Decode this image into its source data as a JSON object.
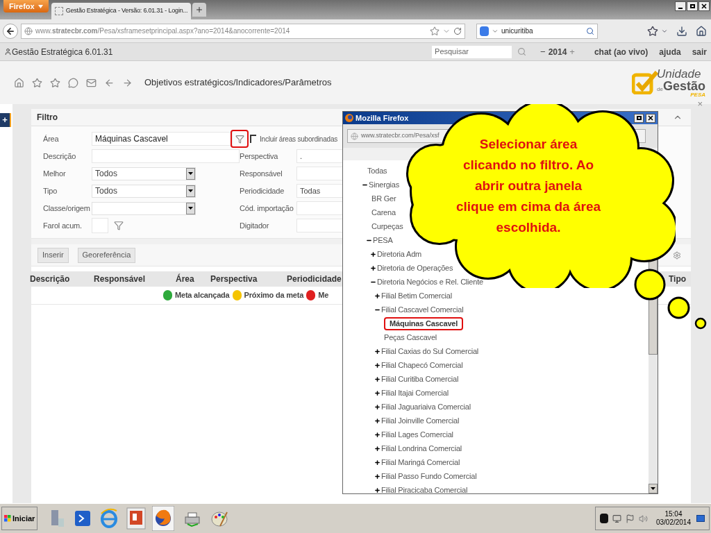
{
  "browser": {
    "menu_button": "Firefox",
    "tab_title": "Gestão Estratégica - Versão: 6.01.31 - Login...",
    "url": "www.**stratecbr.com**/Pesa/xsframesetprincipal.aspx?ano=2014&anocorrente=2014",
    "search_value": "unicuritiba"
  },
  "app_header": {
    "title": "Gestão Estratégica 6.01.31",
    "search_placeholder": "Pesquisar",
    "year_minus": "−",
    "year": "2014",
    "year_plus": "+",
    "links": [
      "chat (ao vivo)",
      "ajuda",
      "sair"
    ]
  },
  "toolbar": {
    "breadcrumb": "Objetivos estratégicos/Indicadores/Parâmetros",
    "close": "×"
  },
  "logo": {
    "line1": "Unidade",
    "small": "de",
    "line2": "Gestão",
    "tag": "PESA"
  },
  "sidebar_toggle": "+",
  "filter": {
    "title": "Filtro",
    "left_fields": [
      {
        "label": "Área",
        "kind": "area",
        "value": "Máquinas Cascavel"
      },
      {
        "label": "Descrição",
        "kind": "text"
      },
      {
        "label": "Melhor",
        "kind": "select",
        "value": "Todos"
      },
      {
        "label": "Tipo",
        "kind": "select",
        "value": "Todos"
      },
      {
        "label": "Classe/origem",
        "kind": "select"
      },
      {
        "label": "Farol acum.",
        "kind": "farol"
      }
    ],
    "include_subareas": {
      "label": "Incluir áreas subordinadas",
      "checked": false
    },
    "right_fields": [
      {
        "label": "Perspectiva",
        "value": "."
      },
      {
        "label": "Responsável"
      },
      {
        "label": "Periodicidade",
        "value": "Todas"
      },
      {
        "label": "Cód. importação"
      },
      {
        "label": "Digitador"
      }
    ]
  },
  "actions": [
    "Inserir",
    "Georeferência"
  ],
  "table": {
    "columns": [
      "Descrição",
      "Responsável",
      "Área",
      "Perspectiva",
      "Periodicidade",
      "Tipo"
    ],
    "legend": [
      {
        "label": "Meta alcançada",
        "color": "#2eaa3c"
      },
      {
        "label": "Próximo da meta",
        "color": "#f5c400"
      },
      {
        "label": "Me",
        "color": "#e02020"
      }
    ]
  },
  "popup": {
    "title": "Mozilla Firefox",
    "url": "www.stratecbr.com/Pesa/xsf",
    "tree": [
      {
        "label": "Todas",
        "selected": false
      },
      {
        "label": "Sinergias",
        "selected": false,
        "expanded": true,
        "children": [
          {
            "label": "BR Ger",
            "selected": false
          },
          {
            "label": "Carena",
            "selected": false
          },
          {
            "label": "Curpeças",
            "selected": false
          },
          {
            "label": "PESA",
            "selected": false,
            "expanded": true,
            "children": [
              {
                "label": "Diretoria Adm",
                "selected": false,
                "expanded": false
              },
              {
                "label": "Diretoria de Operações",
                "selected": false,
                "expanded": false
              },
              {
                "label": "Diretoria Negócios e Rel. Cliente",
                "selected": false,
                "expanded": true,
                "children": [
                  {
                    "label": "Filial Betim Comercial",
                    "selected": false,
                    "expanded": false
                  },
                  {
                    "label": "Filial Cascavel Comercial",
                    "selected": false,
                    "expanded": true,
                    "children": [
                      {
                        "label": "Máquinas Cascavel",
                        "selected": true
                      },
                      {
                        "label": "Peças Cascavel",
                        "selected": false
                      }
                    ]
                  },
                  {
                    "label": "Filial Caxias do Sul Comercial",
                    "selected": false,
                    "expanded": false
                  },
                  {
                    "label": "Filial Chapecó Comercial",
                    "selected": false,
                    "expanded": false
                  },
                  {
                    "label": "Filial Curitiba Comercial",
                    "selected": false,
                    "expanded": false
                  },
                  {
                    "label": "Filial Itajai Comercial",
                    "selected": false,
                    "expanded": false
                  },
                  {
                    "label": "Filial Jaguariaiva Comercial",
                    "selected": false,
                    "expanded": false
                  },
                  {
                    "label": "Filial Joinville Comercial",
                    "selected": false,
                    "expanded": false
                  },
                  {
                    "label": "Filial Lages Comercial",
                    "selected": false,
                    "expanded": false
                  },
                  {
                    "label": "Filial Londrina Comercial",
                    "selected": false,
                    "expanded": false
                  },
                  {
                    "label": "Filial Maringá Comercial",
                    "selected": false,
                    "expanded": false
                  },
                  {
                    "label": "Filial Passo Fundo Comercial",
                    "selected": false,
                    "expanded": false
                  },
                  {
                    "label": "Filial Piracicaba Comercial",
                    "selected": false,
                    "expanded": false
                  }
                ]
              }
            ]
          }
        ]
      }
    ]
  },
  "callout": {
    "lines": [
      "Selecionar área",
      "clicando no filtro. Ao",
      "abrir outra janela",
      "clique em cima da área",
      "escolhida."
    ]
  },
  "taskbar": {
    "start": "Iniciar",
    "time": "15:04",
    "date": "03/02/2014"
  }
}
